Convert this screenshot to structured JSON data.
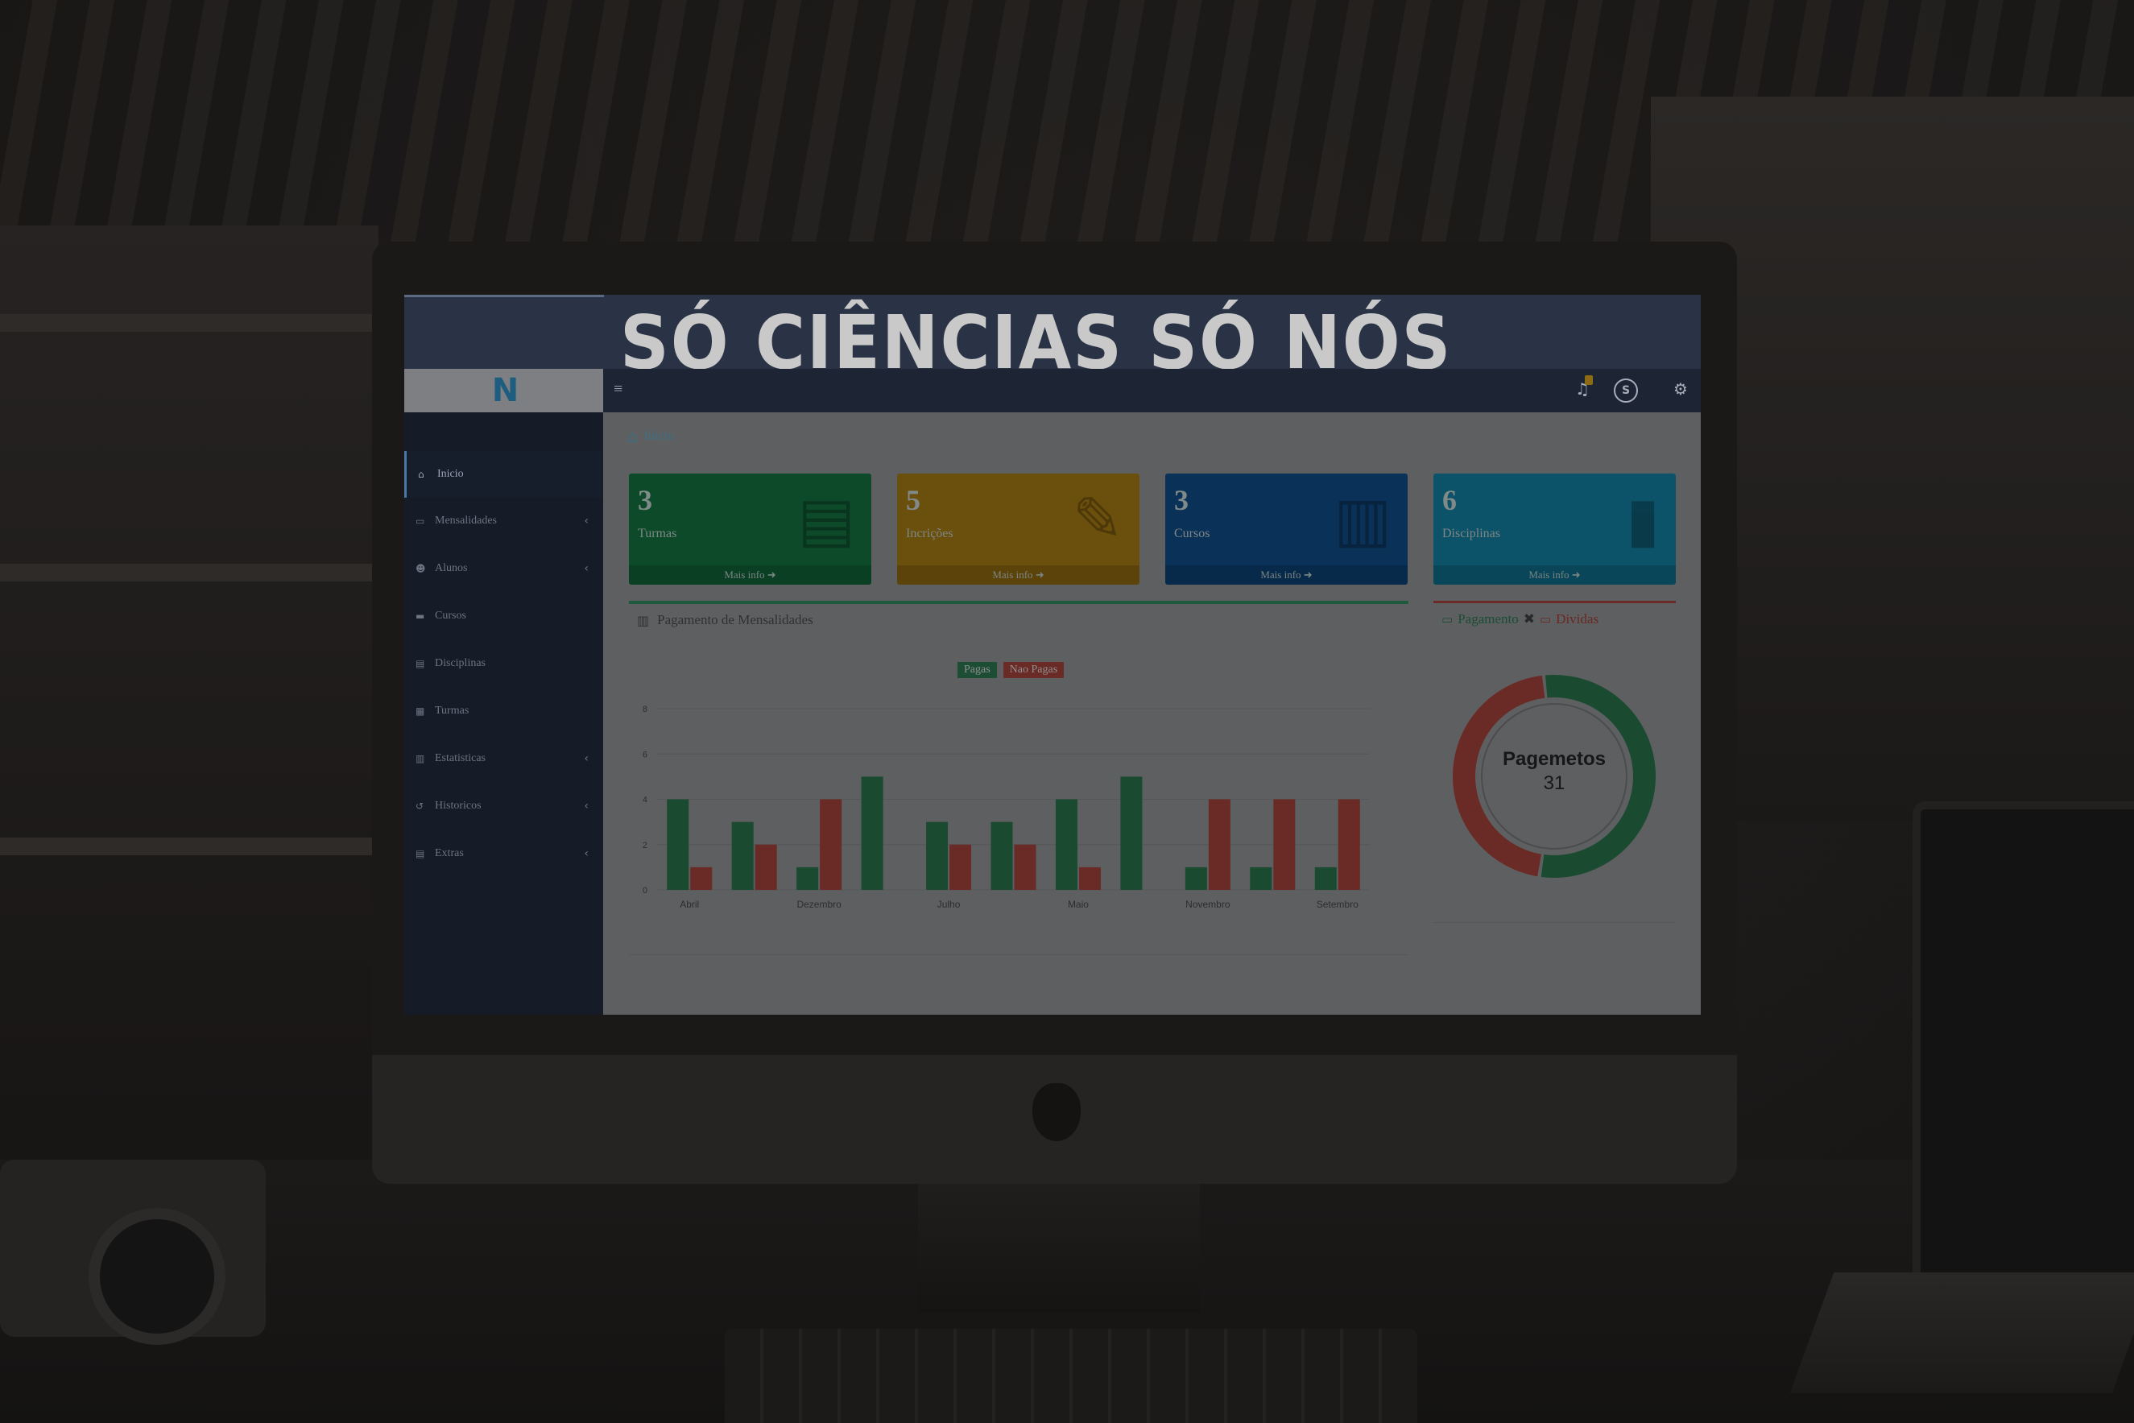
{
  "banner": {
    "title": "SÓ CIÊNCIAS SÓ NÓS"
  },
  "navbar": {
    "logo_text": "N",
    "toggle_icon": "hamburger-icon",
    "bell_icon": "bell-icon",
    "user_icon": "user-avatar-icon",
    "user_glyph": "S",
    "settings_icon": "gears-icon"
  },
  "sidebar": {
    "items": [
      {
        "label": "Inicio",
        "icon": "home-icon",
        "glyph": "⌂",
        "has_caret": false
      },
      {
        "label": "Mensalidades",
        "icon": "money-icon",
        "glyph": "▭",
        "has_caret": true
      },
      {
        "label": "Alunos",
        "icon": "users-icon",
        "glyph": "☻",
        "has_caret": true
      },
      {
        "label": "Cursos",
        "icon": "folder-icon",
        "glyph": "▬",
        "has_caret": false
      },
      {
        "label": "Disciplinas",
        "icon": "book-icon",
        "glyph": "▤",
        "has_caret": false
      },
      {
        "label": "Turmas",
        "icon": "table-icon",
        "glyph": "▦",
        "has_caret": false
      },
      {
        "label": "Estatisticas",
        "icon": "chart-icon",
        "glyph": "▥",
        "has_caret": true
      },
      {
        "label": "Historicos",
        "icon": "history-icon",
        "glyph": "↺",
        "has_caret": true
      },
      {
        "label": "Extras",
        "icon": "book-icon",
        "glyph": "▤",
        "has_caret": true
      }
    ],
    "caret": "‹"
  },
  "breadcrumb": {
    "label": "Inicio",
    "icon": "home-icon"
  },
  "boxes": [
    {
      "value": "3",
      "label": "Turmas",
      "footer": "Mais info ➜",
      "icon": "clipboard-icon"
    },
    {
      "value": "5",
      "label": "Incrições",
      "footer": "Mais info ➜",
      "icon": "pencil-icon"
    },
    {
      "value": "3",
      "label": "Cursos",
      "footer": "Mais info ➜",
      "icon": "book-icon"
    },
    {
      "value": "6",
      "label": "Disciplinas",
      "footer": "Mais info ➜",
      "icon": "bookmark-icon"
    }
  ],
  "colors": {
    "paid": "#1a4a30",
    "unpaid": "#6a2a25"
  },
  "chart_panel": {
    "title": "Pagamento de Mensalidades",
    "icon": "bar-chart-icon"
  },
  "chart_data": {
    "type": "bar",
    "categories": [
      "Abril",
      "",
      "Dezembro",
      "",
      "Julho",
      "",
      "Maio",
      "",
      "Novembro",
      "",
      "Setembro"
    ],
    "series": [
      {
        "name": "Pagas",
        "values": [
          4,
          3,
          1,
          5,
          3,
          3,
          4,
          5,
          1,
          1,
          1
        ]
      },
      {
        "name": "Nao Pagas",
        "values": [
          1,
          2,
          4,
          0,
          2,
          2,
          1,
          0,
          4,
          4,
          4
        ]
      }
    ],
    "ylim": [
      0,
      8
    ],
    "yticks": [
      "0",
      "2",
      "4",
      "6",
      "8"
    ],
    "grid": true,
    "legend": "top-center"
  },
  "donut_panel": {
    "title_paid": "Pagamento",
    "separator": "✖",
    "title_debt": "Dividas",
    "center_label": "Pagemetos",
    "center_value": "31",
    "paid_fraction": 0.54,
    "unpaid_fraction": 0.46
  }
}
